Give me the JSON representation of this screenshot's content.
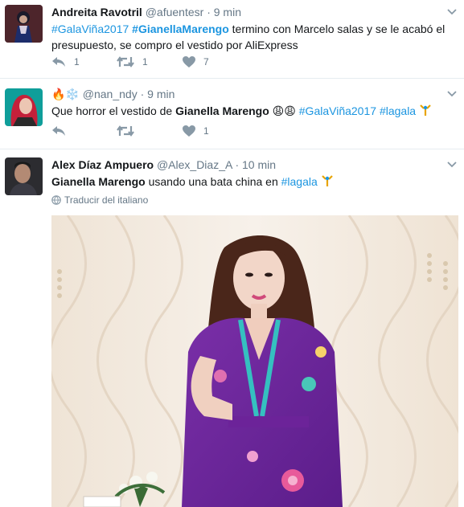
{
  "tweets": [
    {
      "name": "Andreita Ravotril",
      "handle": "@afuentesr",
      "time": "9 min",
      "text_parts": [
        "#GalaViña2017",
        " ",
        "#GianellaMarengo",
        " termino con Marcelo salas y se le acabó el",
        "presupuesto, se compro el vestido por AliExpress"
      ],
      "replies": "1",
      "retweets": "1",
      "likes": "7"
    },
    {
      "name_emoji": "🔥❄️",
      "handle": "@nan_ndy",
      "time": "9 min",
      "text_parts": [
        "Que horror el vestido de ",
        "Gianella Marengo",
        " 😩😩 ",
        "#GalaViña2017",
        " ",
        "#lagala"
      ],
      "retweets": "",
      "likes": "1"
    },
    {
      "name": "Alex Díaz Ampuero",
      "handle": "@Alex_Diaz_A",
      "time": "10 min",
      "text_parts": [
        "Gianella Marengo",
        " usando una bata china en ",
        "#lagala"
      ],
      "translate": "Traducir del italiano"
    }
  ],
  "separator": "·",
  "icons": [
    "reply-icon",
    "retweet-icon",
    "like-icon",
    "caret-down-icon",
    "globe-icon",
    "gala-torch-icon"
  ],
  "colors": {
    "link": "#1b95e0",
    "muted": "#657786",
    "text": "#14171a",
    "border": "#e6ecf0"
  }
}
